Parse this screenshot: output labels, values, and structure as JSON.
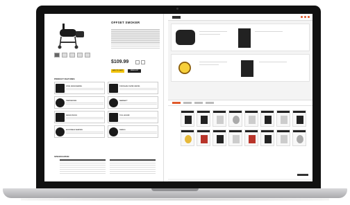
{
  "product": {
    "title": "OFFSET SMOKER",
    "subtitle": "",
    "price": "$109.99",
    "add_to_cart": "ADD TO CART",
    "buy_now": "WISH LIST",
    "features_heading": "PRODUCT FEATURES",
    "features": [
      {
        "label": "STEEL SMOKE BARREL",
        "icon": "smoker-icon"
      },
      {
        "label": "PORCELAIN COATED GRATES",
        "icon": "grate-icon"
      },
      {
        "label": "TEMPERATURE",
        "icon": "thermometer-icon"
      },
      {
        "label": "WARRANTY",
        "icon": "warranty-icon"
      },
      {
        "label": "SMOKE STACKS",
        "icon": "stack-icon"
      },
      {
        "label": "TOOL HOLDER",
        "icon": "tool-icon"
      },
      {
        "label": "ADJUSTABLE DAMPERS",
        "icon": "damper-icon"
      },
      {
        "label": "WHEELS",
        "icon": "wheel-icon"
      }
    ],
    "spec_heading": "SPECIFICATION"
  },
  "colors": {
    "accent": "#e05a2b",
    "button_yellow": "#f0c20a",
    "badge_gold": "#e6b93a"
  }
}
